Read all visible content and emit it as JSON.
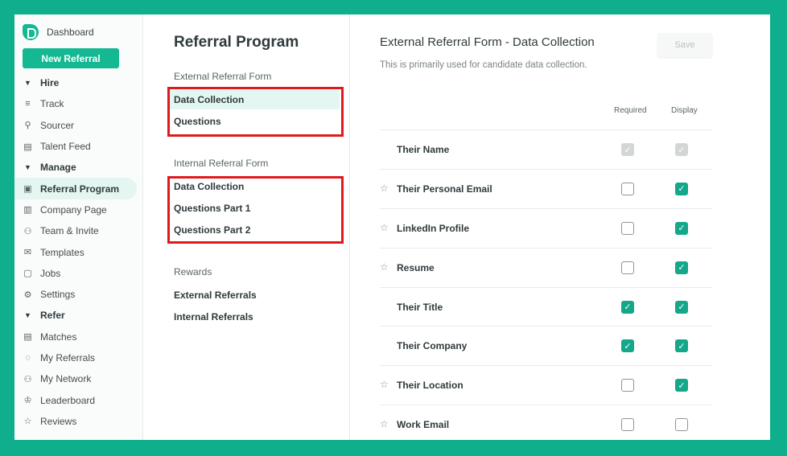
{
  "sidebar": {
    "brand": "Dashboard",
    "new_button": "New Referral",
    "items": [
      {
        "label": "Hire",
        "icon": "caret-down-icon",
        "glyph": "▼",
        "kind": "section",
        "name": "nav-section-hire"
      },
      {
        "label": "Track",
        "icon": "track-icon",
        "glyph": "≡",
        "kind": "item",
        "name": "nav-item-track"
      },
      {
        "label": "Sourcer",
        "icon": "sourcer-icon",
        "glyph": "⚲",
        "kind": "item",
        "name": "nav-item-sourcer"
      },
      {
        "label": "Talent Feed",
        "icon": "talent-feed-icon",
        "glyph": "▤",
        "kind": "item",
        "name": "nav-item-talent-feed"
      },
      {
        "label": "Manage",
        "icon": "caret-down-icon",
        "glyph": "▼",
        "kind": "section",
        "name": "nav-section-manage"
      },
      {
        "label": "Referral Program",
        "icon": "gift-icon",
        "glyph": "▣",
        "kind": "active",
        "name": "nav-item-referral-program"
      },
      {
        "label": "Company Page",
        "icon": "building-icon",
        "glyph": "▥",
        "kind": "item",
        "name": "nav-item-company-page"
      },
      {
        "label": "Team & Invite",
        "icon": "add-user-icon",
        "glyph": "⚇",
        "kind": "item",
        "name": "nav-item-team-invite"
      },
      {
        "label": "Templates",
        "icon": "mail-icon",
        "glyph": "✉",
        "kind": "item",
        "name": "nav-item-templates"
      },
      {
        "label": "Jobs",
        "icon": "briefcase-icon",
        "glyph": "▢",
        "kind": "item",
        "name": "nav-item-jobs"
      },
      {
        "label": "Settings",
        "icon": "gear-icon",
        "glyph": "⚙",
        "kind": "item",
        "name": "nav-item-settings"
      },
      {
        "label": "Refer",
        "icon": "caret-down-icon",
        "glyph": "▼",
        "kind": "section",
        "name": "nav-section-refer"
      },
      {
        "label": "Matches",
        "icon": "id-card-icon",
        "glyph": "▤",
        "kind": "item",
        "name": "nav-item-matches"
      },
      {
        "label": "My Referrals",
        "icon": "dotted-circle-icon",
        "glyph": "◌",
        "kind": "item",
        "name": "nav-item-my-referrals"
      },
      {
        "label": "My Network",
        "icon": "network-icon",
        "glyph": "⚇",
        "kind": "item",
        "name": "nav-item-my-network"
      },
      {
        "label": "Leaderboard",
        "icon": "trophy-icon",
        "glyph": "♔",
        "kind": "item",
        "name": "nav-item-leaderboard"
      },
      {
        "label": "Reviews",
        "icon": "star-icon",
        "glyph": "☆",
        "kind": "item",
        "name": "nav-item-reviews"
      }
    ]
  },
  "program": {
    "title": "Referral Program",
    "external_heading": "External Referral Form",
    "external_links": [
      "Data Collection",
      "Questions"
    ],
    "internal_heading": "Internal Referral Form",
    "internal_links": [
      "Data Collection",
      "Questions Part 1",
      "Questions Part 2"
    ],
    "rewards_heading": "Rewards",
    "rewards_links": [
      "External Referrals",
      "Internal Referrals"
    ]
  },
  "form": {
    "title": "External Referral Form - Data Collection",
    "subtitle": "This is primarily used for candidate data collection.",
    "save_label": "Save",
    "col_required": "Required",
    "col_display": "Display",
    "fields": [
      {
        "label": "Their Name",
        "star": false,
        "required": "disabled",
        "display": "disabled"
      },
      {
        "label": "Their Personal Email",
        "star": true,
        "required": "unchecked",
        "display": "checked"
      },
      {
        "label": "LinkedIn Profile",
        "star": true,
        "required": "unchecked",
        "display": "checked"
      },
      {
        "label": "Resume",
        "star": true,
        "required": "unchecked",
        "display": "checked"
      },
      {
        "label": "Their Title",
        "star": false,
        "required": "checked",
        "display": "checked"
      },
      {
        "label": "Their Company",
        "star": false,
        "required": "checked",
        "display": "checked"
      },
      {
        "label": "Their Location",
        "star": true,
        "required": "unchecked",
        "display": "checked"
      },
      {
        "label": "Work Email",
        "star": true,
        "required": "unchecked",
        "display": "unchecked"
      }
    ]
  },
  "colors": {
    "accent": "#14b892",
    "highlight_box": "#e0191d",
    "frame": "#0fae8c"
  }
}
